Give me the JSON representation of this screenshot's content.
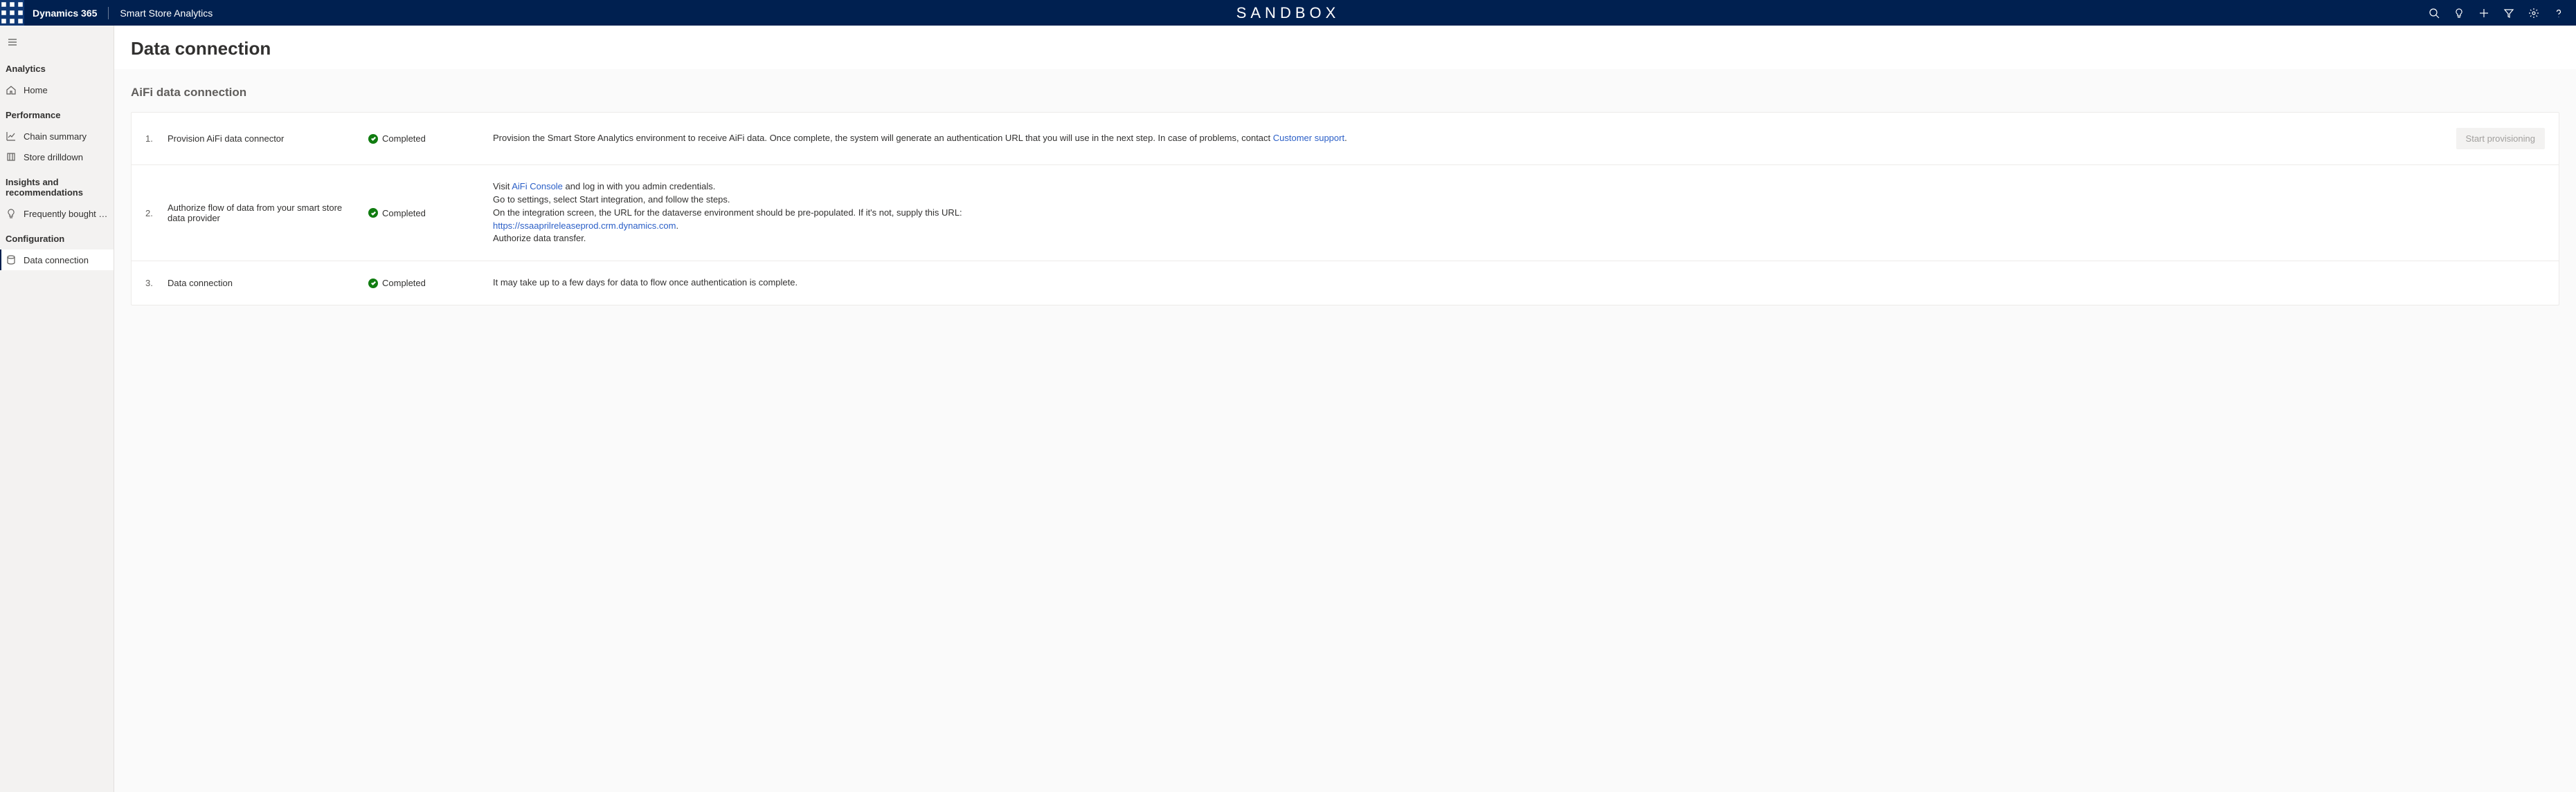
{
  "topbar": {
    "brand": "Dynamics 365",
    "app": "Smart Store Analytics",
    "env": "SANDBOX"
  },
  "sidebar": {
    "groups": [
      {
        "title": "Analytics",
        "items": [
          {
            "label": "Home",
            "icon": "home"
          }
        ]
      },
      {
        "title": "Performance",
        "items": [
          {
            "label": "Chain summary",
            "icon": "chart"
          },
          {
            "label": "Store drilldown",
            "icon": "store"
          }
        ]
      },
      {
        "title": "Insights and recommendations",
        "items": [
          {
            "label": "Frequently bought t...",
            "icon": "bulb"
          }
        ]
      },
      {
        "title": "Configuration",
        "items": [
          {
            "label": "Data connection",
            "icon": "data",
            "active": true
          }
        ]
      }
    ]
  },
  "page": {
    "title": "Data connection",
    "section": "AiFi data connection",
    "steps": [
      {
        "num": "1.",
        "title": "Provision AiFi data connector",
        "status": "Completed",
        "desc_pre": "Provision the Smart Store Analytics environment to receive AiFi data. Once complete, the system will generate an authentication URL that you will use in the next step. In case of problems, contact ",
        "desc_link1": "Customer support",
        "desc_post": ".",
        "action": "Start provisioning"
      },
      {
        "num": "2.",
        "title": "Authorize flow of data from your smart store data provider",
        "status": "Completed",
        "line1_pre": "Visit ",
        "line1_link": "AiFi Console",
        "line1_post": " and log in with you admin credentials.",
        "line2": "Go to settings, select Start integration, and follow the steps.",
        "line3": "On the integration screen, the URL for the dataverse environment should be pre-populated. If it's not, supply this URL:",
        "line4_link": "https://ssaaprilreleaseprod.crm.dynamics.com",
        "line4_post": ".",
        "line5": "Authorize data transfer."
      },
      {
        "num": "3.",
        "title": "Data connection",
        "status": "Completed",
        "desc": "It may take up to a few days for data to flow once authentication is complete."
      }
    ]
  }
}
